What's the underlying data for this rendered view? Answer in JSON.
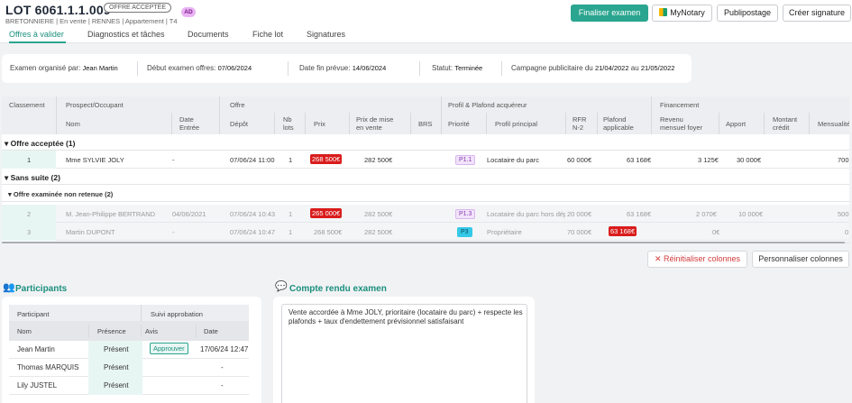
{
  "header": {
    "title": "LOT 6061.1.1.009",
    "status": "OFFRE ACCEPTÉE",
    "badge": "AD",
    "subtitle": "BRETONNIERE | En vente | RENNES | Appartement | T4",
    "buttons": {
      "finalize": "Finaliser examen",
      "mynotary": "MyNotary",
      "publipostage": "Publipostage",
      "sign": "Créer signature"
    }
  },
  "tabs": [
    "Offres à valider",
    "Diagnostics et tâches",
    "Documents",
    "Fiche lot",
    "Signatures"
  ],
  "info": {
    "organizer_label": "Examen organisé par:",
    "organizer": "Jean Martin",
    "start_label": "Début examen offres:",
    "start": "07/06/2024",
    "end_label": "Date fin prévue:",
    "end": "14/06/2024",
    "status_label": "Statut:",
    "status": "Terminée",
    "campaign_label": "Campagne publicitaire du",
    "campaign_from": "21/04/2022",
    "campaign_mid": "au",
    "campaign_to": "21/05/2022"
  },
  "table": {
    "groups": [
      "Classement",
      "Prospect/Occupant",
      "Offre",
      "Profil & Plafond acquéreur",
      "Financement"
    ],
    "columns": {
      "nom": "Nom",
      "date_entree": [
        "Date",
        "Entrée"
      ],
      "depot": "Dépôt",
      "nb_lots": [
        "Nb",
        "lots"
      ],
      "prix": "Prix",
      "prix_mise": [
        "Prix de mise",
        "en vente"
      ],
      "brs": "BRS",
      "priorite": "Priorité",
      "profil": "Profil principal",
      "rfr": [
        "RFR",
        "N-2"
      ],
      "plafond": [
        "Plafond",
        "applicable"
      ],
      "revenu": [
        "Revenu",
        "mensuel foyer"
      ],
      "apport": "Apport",
      "montant": [
        "Montant",
        "crédit"
      ],
      "mensualite": "Mensualité"
    },
    "section_accepted": "Offre acceptée (1)",
    "section_sans_suite": "Sans suite (2)",
    "subsection_non_retenue": "Offre examinée non retenue (2)",
    "rows_accepted": [
      {
        "rank": "1",
        "name": "Mme SYLVIE JOLY",
        "date_entree": "-",
        "depot": "07/06/24 11:00",
        "nb_lots": "1",
        "prix": "268 500€",
        "prix_mise": "282 500€",
        "priorite": "P1.1",
        "profil": "Locataire du parc",
        "rfr": "60 000€",
        "plafond": "63 168€",
        "revenu": "3 125€",
        "apport": "30 000€",
        "mensualite": "700"
      }
    ],
    "rows_non_retenue": [
      {
        "rank": "2",
        "name": "M. Jean-Philippe BERTRAND",
        "date_entree": "04/06/2021",
        "depot": "07/06/24 10:43",
        "nb_lots": "1",
        "prix": "265 000€",
        "prix_mise": "282 500€",
        "priorite": "P1.3",
        "profil": "Locataire du parc hors dép",
        "rfr": "20 000€",
        "plafond": "63 168€",
        "revenu": "2 070€",
        "apport": "10 000€",
        "mensualite": "500"
      },
      {
        "rank": "3",
        "name": "Martin DUPONT",
        "date_entree": "-",
        "depot": "07/06/24 10:47",
        "nb_lots": "1",
        "prix": "268 500€",
        "prix_mise": "282 500€",
        "priorite": "P3",
        "profil": "Propriétaire",
        "rfr": "70 000€",
        "plafond": "63 168€",
        "revenu": "0€",
        "apport": "",
        "mensualite": "0"
      }
    ]
  },
  "actions": {
    "reset": "Réinitialiser colonnes",
    "customize": "Personnaliser colonnes"
  },
  "participants": {
    "title": "Participants",
    "head_participant": "Participant",
    "head_suivi": "Suivi approbation",
    "col_nom": "Nom",
    "col_presence": "Présence",
    "col_avis": "Avis",
    "col_date": "Date",
    "rows": [
      {
        "name": "Jean Martin",
        "presence": "Présent",
        "avis": "Approuver",
        "date": "17/06/24 12:47"
      },
      {
        "name": "Thomas MARQUIS",
        "presence": "Présent",
        "avis": "",
        "date": "-"
      },
      {
        "name": "Lily JUSTEL",
        "presence": "Présent",
        "avis": "",
        "date": "-"
      }
    ]
  },
  "compte_rendu": {
    "title": "Compte rendu examen",
    "text": "Vente accordée à Mme JOLY, prioritaire (locataire du parc) + respecte les plafonds + taux d'endettement prévisionnel satisfaisant"
  },
  "colors": {
    "accent": "#2aa58f",
    "danger": "#d91c1c",
    "badge": "#e9b2f2"
  }
}
